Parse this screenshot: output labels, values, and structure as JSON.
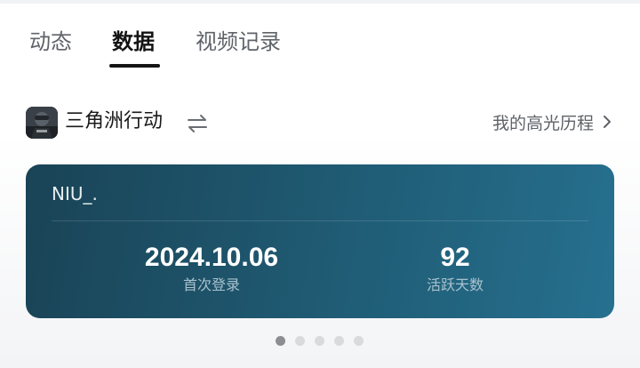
{
  "tabs": [
    {
      "label": "动态",
      "active": false
    },
    {
      "label": "数据",
      "active": true
    },
    {
      "label": "视频记录",
      "active": false
    }
  ],
  "game": {
    "title": "三角洲行动",
    "switch_icon": "swap-arrows-icon",
    "highlight_link": "我的高光历程",
    "highlight_icon": "chevron-right-icon"
  },
  "card": {
    "player_name": "NIU_.",
    "stats": [
      {
        "value": "2024.10.06",
        "label": "首次登录"
      },
      {
        "value": "92",
        "label": "活跃天数"
      }
    ],
    "gradient": [
      "#1a4356",
      "#26708f"
    ]
  },
  "pager": {
    "total": 5,
    "active_index": 0
  },
  "colors": {
    "accent": "#141414",
    "muted_text": "#5f6369",
    "card_label": "#a9c2ce"
  }
}
